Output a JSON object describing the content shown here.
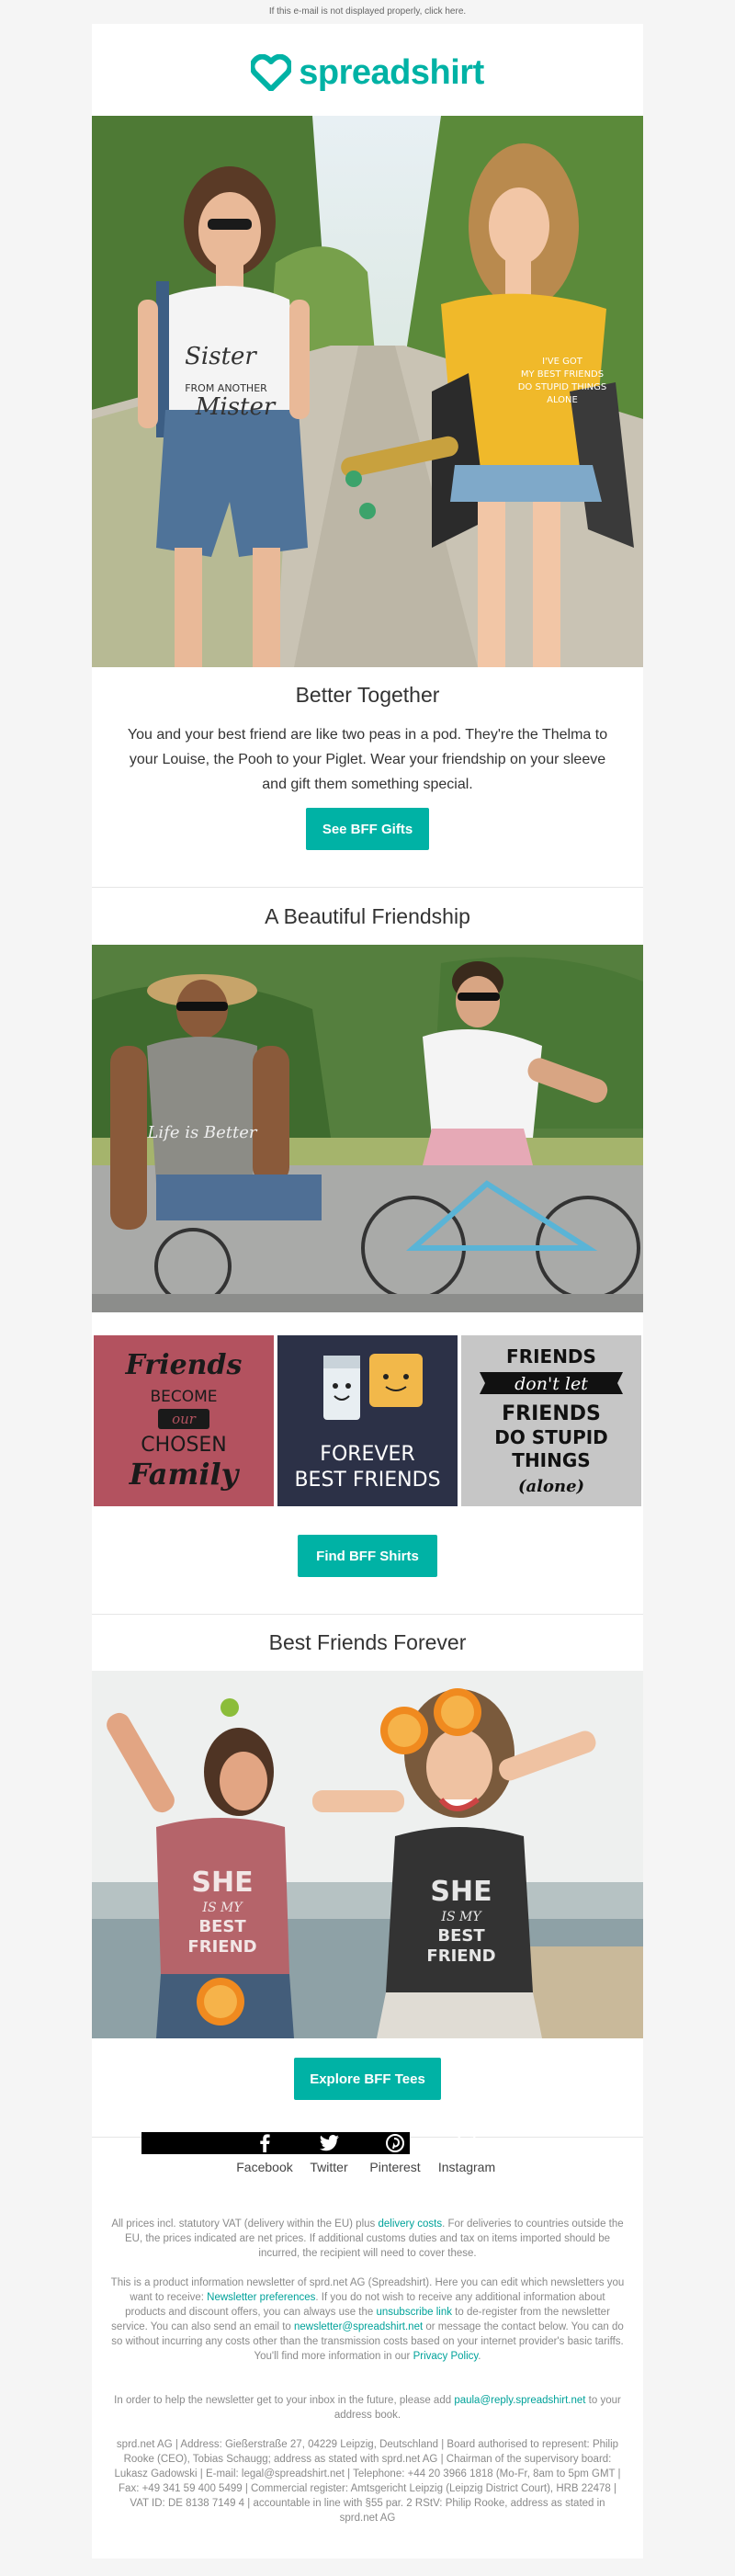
{
  "preheader": {
    "text": "If this e-mail is not displayed properly, click here."
  },
  "brand": {
    "name": "spreadshirt",
    "accent": "#00b2a5"
  },
  "hero": {
    "shirt_left_line1": "Sister",
    "shirt_left_line2": "FROM ANOTHER",
    "shirt_left_line3": "Mister",
    "shirt_right_line1": "I'VE GOT",
    "shirt_right_line2": "MY BEST FRIENDS",
    "shirt_right_line3": "DO STUPID THINGS",
    "shirt_right_line4": "ALONE"
  },
  "section1": {
    "title": "Better Together",
    "body": "You and your best friend are like two peas in a pod. They're the Thelma to your Louise, the Pooh to your Piglet. Wear your friendship on your sleeve and gift them something special.",
    "button": "See BFF Gifts"
  },
  "section2": {
    "title": "A Beautiful Friendship",
    "photo_shirt_text": "Life is Better",
    "tiles": [
      {
        "line1": "Friends",
        "line2": "BECOME",
        "line3": "our",
        "line4": "CHOSEN",
        "line5": "Family",
        "bg": "#b3525f"
      },
      {
        "line1": "FOREVER",
        "line2": "BEST FRIENDS",
        "bg": "#2c3147"
      },
      {
        "line1": "FRIENDS",
        "line2": "don't let",
        "line3": "FRIENDS",
        "line4": "DO STUPID",
        "line5": "THINGS",
        "line6": "(alone)",
        "bg": "#c6c6c6"
      }
    ],
    "button": "Find BFF Shirts"
  },
  "section3": {
    "title": "Best Friends Forever",
    "shirt_line1": "SHE",
    "shirt_line2": "IS MY",
    "shirt_line3": "BEST",
    "shirt_line4": "FRIEND",
    "button": "Explore BFF Tees"
  },
  "social": [
    {
      "label": "Facebook",
      "icon": "facebook-icon"
    },
    {
      "label": "Twitter",
      "icon": "twitter-icon"
    },
    {
      "label": "Pinterest",
      "icon": "pinterest-icon"
    },
    {
      "label": "Instagram",
      "icon": "instagram-icon"
    }
  ],
  "footer": {
    "p1_a": "All prices incl. statutory VAT (delivery within the EU) plus ",
    "p1_link": "delivery costs",
    "p1_b": ". For deliveries to countries outside the EU, the prices indicated are net prices. If additional customs duties and tax on items imported should be incurred, the recipient will need to cover these.",
    "p2_a": "This is a product information newsletter of sprd.net AG (Spreadshirt). Here you can edit which newsletters you want to receive: ",
    "p2_link1": "Newsletter preferences",
    "p2_b": ". If you do not wish to receive any additional information about products and discount offers, you can always use the ",
    "p2_link2": "unsubscribe link",
    "p2_c": " to de-register from the newsletter service. You can also send an email to ",
    "p2_link3": "newsletter@spreadshirt.net",
    "p2_d": " or message the contact below. You can do so without incurring any costs other than the transmission costs based on your internet provider's basic tariffs. You'll find more information in our ",
    "p2_link4": "Privacy Policy",
    "p2_e": ".",
    "p3_a": "In order to help the newsletter get to your inbox in the future, please add ",
    "p3_link": "paula@reply.spreadshirt.net",
    "p3_b": " to your address book.",
    "p4": "sprd.net AG | Address: Gießerstraße 27, 04229 Leipzig, Deutschland | Board authorised to represent: Philip Rooke (CEO), Tobias Schaugg; address as stated with sprd.net AG | Chairman of the supervisory board: Lukasz Gadowski | E-mail: legal@spreadshirt.net | Telephone: +44 20 3966 1818 (Mo-Fr, 8am to 5pm GMT | Fax: +49 341 59 400 5499 | Commercial register: Amtsgericht Leipzig (Leipzig District Court), HRB 22478 | VAT ID: DE 8138 7149 4 | accountable in line with §55 par. 2 RStV: Philip Rooke, address as stated in sprd.net AG"
  }
}
